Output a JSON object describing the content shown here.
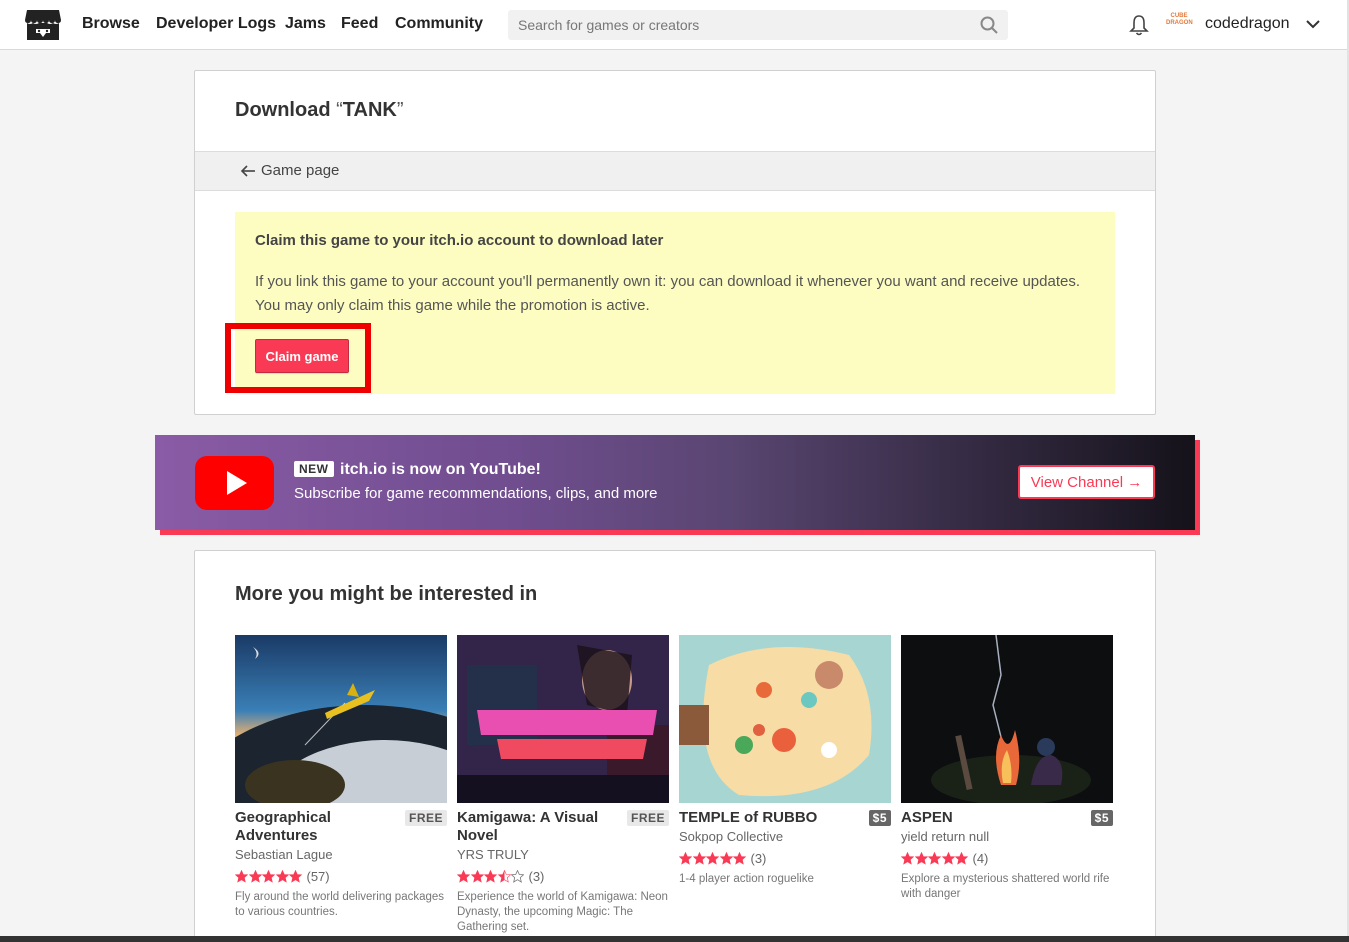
{
  "header": {
    "nav": [
      "Browse",
      "Developer Logs",
      "Jams",
      "Feed",
      "Community"
    ],
    "search_placeholder": "Search for games or creators",
    "username": "codedragon",
    "avatar_text": "CUBE DRAGON"
  },
  "download": {
    "title_prefix": "Download ",
    "open_quote": "“",
    "game_name": "TANK",
    "close_quote": "”",
    "back_label": "Game page"
  },
  "claim": {
    "title": "Claim this game to your itch.io account to download later",
    "body": "If you link this game to your account you'll permanently own it: you can download it whenever you want and receive updates. You may only claim this game while the promotion is active.",
    "button": "Claim game"
  },
  "youtube": {
    "badge": "NEW",
    "title": "itch.io is now on YouTube!",
    "subtitle": "Subscribe for game recommendations, clips, and more",
    "button": "View Channel →"
  },
  "recommendations": {
    "title": "More you might be interested in",
    "games": [
      {
        "title": "Geographical Adventures",
        "price": "FREE",
        "author": "Sebastian Lague",
        "rating": 5,
        "count": "(57)",
        "desc": "Fly around the world delivering packages to various countries."
      },
      {
        "title": "Kamigawa: A Visual Novel",
        "price": "FREE",
        "author": "YRS TRULY",
        "rating": 3.5,
        "count": "(3)",
        "desc": "Experience the world of Kamigawa: Neon Dynasty, the upcoming Magic: The Gathering set."
      },
      {
        "title": "TEMPLE of RUBBO",
        "price": "$5",
        "author": "Sokpop Collective",
        "rating": 5,
        "count": "(3)",
        "desc": "1-4 player action roguelike"
      },
      {
        "title": "ASPEN",
        "price": "$5",
        "author": "yield return null",
        "rating": 5,
        "count": "(4)",
        "desc": "Explore a mysterious shattered world rife with danger"
      }
    ]
  },
  "colors": {
    "accent": "#fa3a55",
    "claim_bg": "#fdfdc2",
    "highlight": "#ee0000"
  }
}
